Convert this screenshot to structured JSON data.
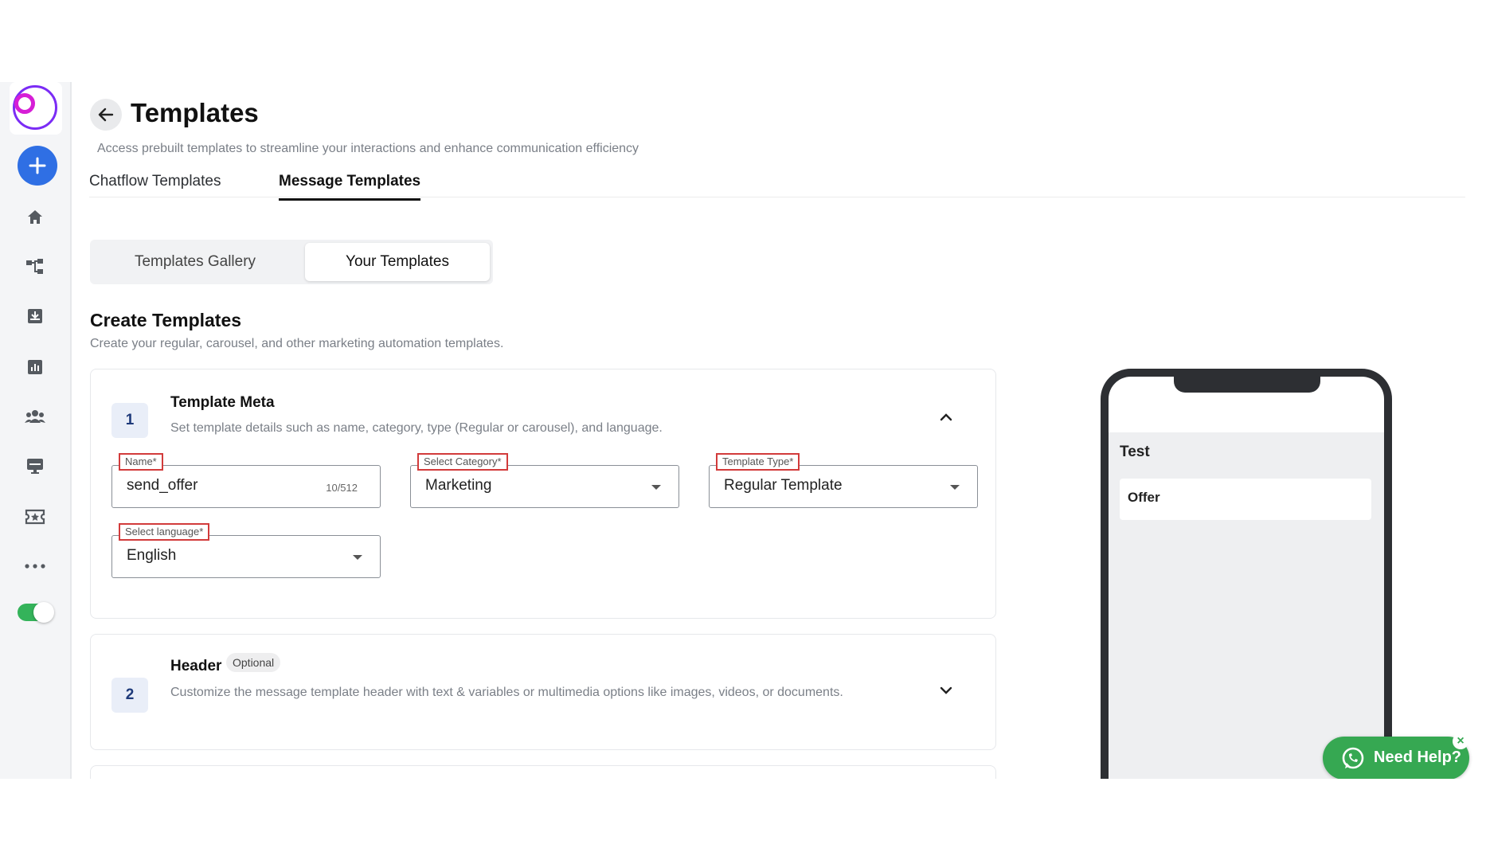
{
  "header": {
    "title": "Templates",
    "subtitle": "Access prebuilt templates to streamline your interactions and enhance communication efficiency"
  },
  "tabs": [
    {
      "label": "Chatflow Templates",
      "active": false
    },
    {
      "label": "Message Templates",
      "active": true
    }
  ],
  "segmented": {
    "gallery": "Templates Gallery",
    "yours": "Your Templates",
    "selected": "Your Templates"
  },
  "create": {
    "title": "Create Templates",
    "subtitle": "Create your regular, carousel, and other marketing automation templates."
  },
  "meta_card": {
    "step": "1",
    "title": "Template Meta",
    "description": "Set template details such as name, category, type (Regular or carousel), and language.",
    "name": {
      "label": "Name*",
      "value": "send_offer",
      "count": "10/512"
    },
    "category": {
      "label": "Select Category*",
      "value": "Marketing"
    },
    "type": {
      "label": "Template Type*",
      "value": "Regular Template"
    },
    "language": {
      "label": "Select language*",
      "value": "English"
    }
  },
  "header_card": {
    "step": "2",
    "title": "Header",
    "badge": "Optional",
    "description": "Customize the message template header with text & variables or multimedia options like images, videos, or documents."
  },
  "preview": {
    "title": "Test",
    "message": "Offer"
  },
  "help": {
    "label": "Need Help?",
    "close": "×"
  },
  "colors": {
    "accent": "#2f6fe4",
    "help_green": "#36a852",
    "label_border": "#d23b3b"
  },
  "icons": [
    "logo",
    "plus-icon",
    "home-icon",
    "flow-icon",
    "inbox-icon",
    "chart-icon",
    "users-icon",
    "monitor-icon",
    "ticket-icon",
    "more-icon",
    "toggle",
    "back-arrow-icon",
    "chevron-up-icon",
    "chevron-down-icon",
    "whatsapp-icon",
    "close-icon"
  ]
}
